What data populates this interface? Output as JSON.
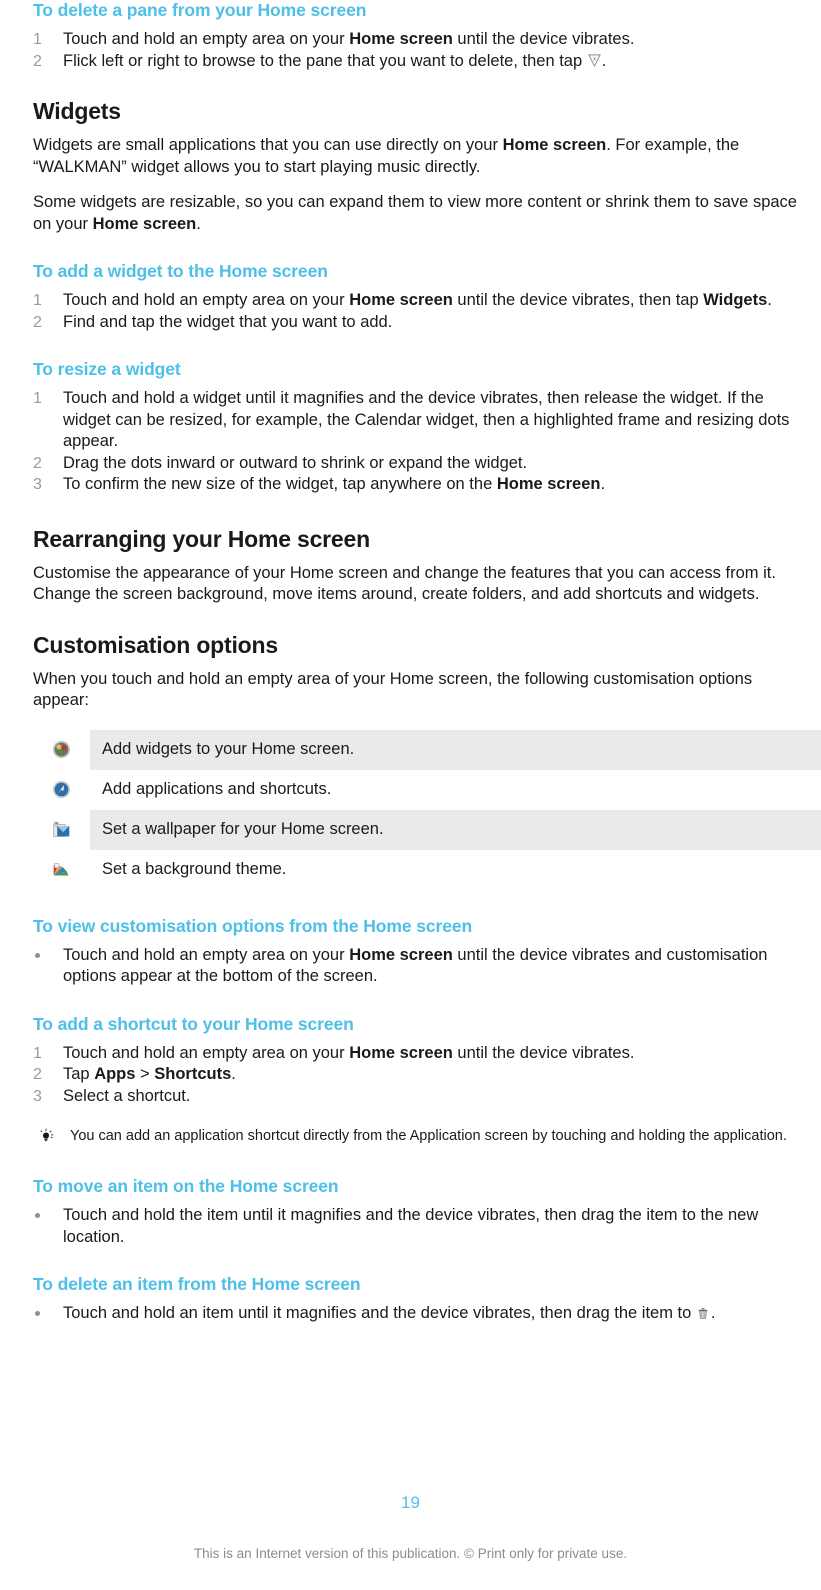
{
  "document": {
    "page_number": "19",
    "footer_note": "This is an Internet version of this publication. © Print only for private use.",
    "heading_color": "#4DBFE8",
    "body_color": "#1a1a1a",
    "row_shade_color": "#eaeaea",
    "number_color": "#9a9a9a"
  },
  "sections": {
    "delete_pane": {
      "heading": "To delete a pane from your Home screen",
      "steps": [
        {
          "num": "1",
          "parts": [
            {
              "t": "Touch and hold an empty area on your ",
              "b": false
            },
            {
              "t": "Home screen",
              "b": true
            },
            {
              "t": " until the device vibrates.",
              "b": false
            }
          ]
        },
        {
          "num": "2",
          "parts": [
            {
              "t": "Flick left or right to browse to the pane that you want to delete, then tap ",
              "b": false
            }
          ],
          "trailing_icon": "delete-pane-icon",
          "trailing_text": "."
        }
      ]
    },
    "widgets": {
      "heading": "Widgets",
      "para1": [
        {
          "t": "Widgets are small applications that you can use directly on your ",
          "b": false
        },
        {
          "t": "Home screen",
          "b": true
        },
        {
          "t": ". For example, the “WALKMAN” widget allows you to start playing music directly.",
          "b": false
        }
      ],
      "para2": [
        {
          "t": "Some widgets are resizable, so you can expand them to view more content or shrink them to save space on your ",
          "b": false
        },
        {
          "t": "Home screen",
          "b": true
        },
        {
          "t": ".",
          "b": false
        }
      ],
      "add_widget": {
        "heading": "To add a widget to the Home screen",
        "steps": [
          {
            "num": "1",
            "parts": [
              {
                "t": "Touch and hold an empty area on your ",
                "b": false
              },
              {
                "t": "Home screen",
                "b": true
              },
              {
                "t": " until the device vibrates, then tap ",
                "b": false
              },
              {
                "t": "Widgets",
                "b": true
              },
              {
                "t": ".",
                "b": false
              }
            ]
          },
          {
            "num": "2",
            "parts": [
              {
                "t": "Find and tap the widget that you want to add.",
                "b": false
              }
            ]
          }
        ]
      },
      "resize_widget": {
        "heading": "To resize a widget",
        "steps": [
          {
            "num": "1",
            "parts": [
              {
                "t": "Touch and hold a widget until it magnifies and the device vibrates, then release the widget. If the widget can be resized, for example, the Calendar widget, then a highlighted frame and resizing dots appear.",
                "b": false
              }
            ]
          },
          {
            "num": "2",
            "parts": [
              {
                "t": "Drag the dots inward or outward to shrink or expand the widget.",
                "b": false
              }
            ]
          },
          {
            "num": "3",
            "parts": [
              {
                "t": "To confirm the new size of the widget, tap anywhere on the ",
                "b": false
              },
              {
                "t": "Home screen",
                "b": true
              },
              {
                "t": ".",
                "b": false
              }
            ]
          }
        ]
      }
    },
    "rearranging": {
      "heading": "Rearranging your Home screen",
      "para1": [
        {
          "t": "Customise the appearance of your Home screen and change the features that you can access from it. Change the screen background, move items around, create folders, and add shortcuts and widgets.",
          "b": false
        }
      ]
    },
    "customisation_options": {
      "heading": "Customisation options",
      "para1": [
        {
          "t": "When you touch and hold an empty area of your Home screen, the following customisation options appear:",
          "b": false
        }
      ],
      "table": {
        "rows": [
          {
            "icon": "widgets-globe-icon",
            "desc": "Add widgets to your Home screen.",
            "shaded": true
          },
          {
            "icon": "apps-shortcut-icon",
            "desc": "Add applications and shortcuts.",
            "shaded": false
          },
          {
            "icon": "wallpaper-icon",
            "desc": "Set a wallpaper for your Home screen.",
            "shaded": true
          },
          {
            "icon": "theme-icon",
            "desc": "Set a background theme.",
            "shaded": false
          }
        ]
      },
      "view_options": {
        "heading": "To view customisation options from the Home screen",
        "bullets": [
          {
            "parts": [
              {
                "t": "Touch and hold an empty area on your ",
                "b": false
              },
              {
                "t": "Home screen",
                "b": true
              },
              {
                "t": " until the device vibrates and customisation options appear at the bottom of the screen.",
                "b": false
              }
            ]
          }
        ]
      },
      "add_shortcut": {
        "heading": "To add a shortcut to your Home screen",
        "steps": [
          {
            "num": "1",
            "parts": [
              {
                "t": "Touch and hold an empty area on your ",
                "b": false
              },
              {
                "t": "Home screen",
                "b": true
              },
              {
                "t": " until the device vibrates.",
                "b": false
              }
            ]
          },
          {
            "num": "2",
            "parts": [
              {
                "t": "Tap ",
                "b": false
              },
              {
                "t": "Apps",
                "b": true
              },
              {
                "t": " > ",
                "b": false
              },
              {
                "t": "Shortcuts",
                "b": true
              },
              {
                "t": ".",
                "b": false
              }
            ]
          },
          {
            "num": "3",
            "parts": [
              {
                "t": "Select a shortcut.",
                "b": false
              }
            ]
          }
        ],
        "tip": "You can add an application shortcut directly from the Application screen by touching and holding the application."
      },
      "move_item": {
        "heading": "To move an item on the Home screen",
        "bullets": [
          {
            "parts": [
              {
                "t": "Touch and hold the item until it magnifies and the device vibrates, then drag the item to the new location.",
                "b": false
              }
            ]
          }
        ]
      },
      "delete_item": {
        "heading": "To delete an item from the Home screen",
        "bullets": [
          {
            "parts": [
              {
                "t": "Touch and hold an item until it magnifies and the device vibrates, then drag the item to ",
                "b": false
              }
            ],
            "trailing_icon": "trash-icon",
            "trailing_text": "."
          }
        ]
      }
    }
  }
}
